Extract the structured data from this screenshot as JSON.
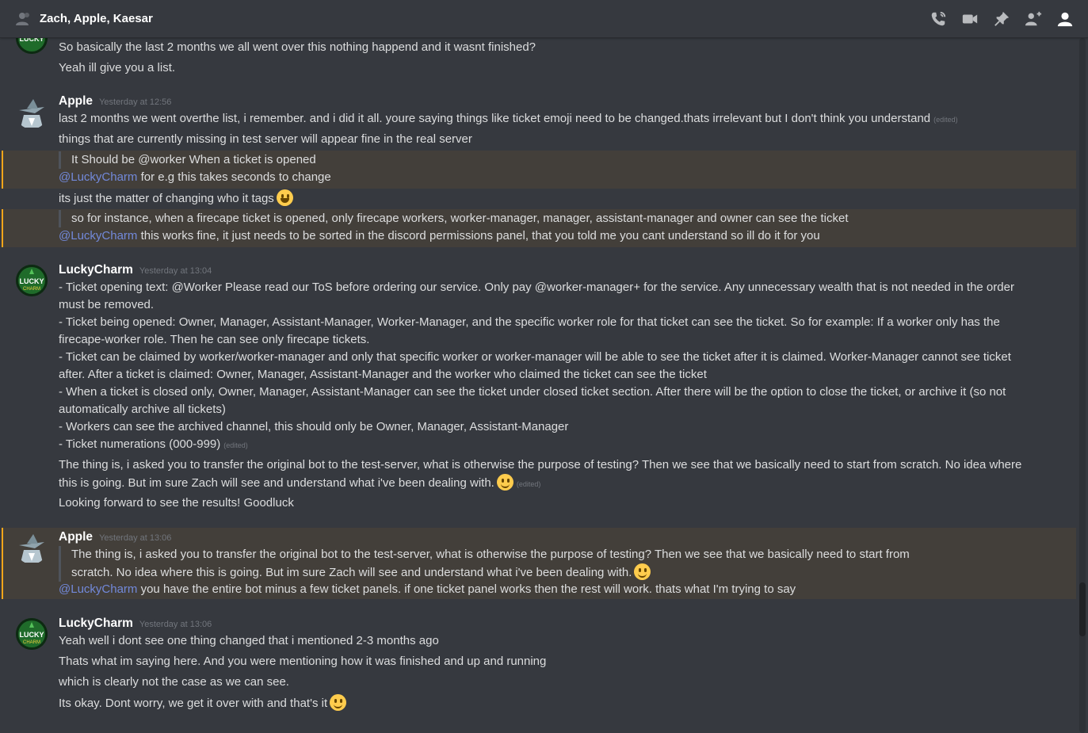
{
  "header": {
    "title": "Zach, Apple, Kaesar",
    "icons": [
      "people-icon",
      "call-icon",
      "video-icon",
      "pin-icon",
      "add-member-icon",
      "member-list-icon"
    ]
  },
  "emoji_names": [
    "grinning",
    "slight_smile"
  ],
  "messages": [
    {
      "lines": [
        "So basically the last 2 months we all went over this nothing happend and it wasnt finished?",
        "Yeah ill give you a list."
      ]
    },
    {
      "author": "Apple",
      "timestamp": "Yesterday at 12:56",
      "line1": "last 2 months we went overthe list, i remember. and i did it all. youre saying things like ticket emoji need to be changed.thats irrelevant but I don't think you understand",
      "line1_edited": "(edited)",
      "line2": "things that are currently missing in test server will appear fine in the real server",
      "quote1": "It Should be @worker When a ticket is opened",
      "mention1": "@LuckyCharm",
      "reply1": " for e.g this takes seconds to change",
      "line3": "its just the matter of changing who it tags",
      "quote2": "so for instance, when a firecape ticket is opened, only firecape workers, worker-manager, manager, assistant-manager and owner can see the ticket",
      "mention2": "@LuckyCharm",
      "reply2": " this works fine, it just needs to be sorted in the discord permissions panel, that you told me you cant understand so ill do it for you"
    },
    {
      "author": "LuckyCharm",
      "timestamp": "Yesterday at 13:04",
      "l1": "- Ticket opening text: @Worker Please read our ToS before ordering our service. Only pay @worker-manager+ for the service. Any unnecessary wealth that is not needed in the order",
      "l2": "must be removed.",
      "l3": "- Ticket being opened: Owner, Manager, Assistant-Manager, Worker-Manager, and the specific worker role for that ticket can see the ticket. So for example: If a worker only has the",
      "l4": "firecape-worker role. Then he can see only firecape tickets.",
      "l5": "- Ticket can be claimed by worker/worker-manager and only that specific worker or worker-manager will be able to see the ticket after it is claimed. Worker-Manager cannot see ticket",
      "l6": "after. After a ticket is claimed: Owner, Manager, Assistant-Manager and the worker who claimed the ticket can see the ticket",
      "l7": "- When a ticket is closed only, Owner, Manager, Assistant-Manager can see the ticket under closed ticket section. After there will be the option to close the ticket, or archive it (so not",
      "l8": "automatically archive all tickets)",
      "l9": "- Workers can see the archived channel, this should only be Owner, Manager, Assistant-Manager",
      "l10": "- Ticket numerations (000-999)",
      "l10_edited": "(edited)",
      "l11": "The thing is, i asked you to transfer the original bot to the test-server, what is otherwise the purpose of testing? Then we see that we basically need to start from scratch. No idea where",
      "l12": "this is going. But im sure Zach will see and understand what i've been dealing with.",
      "l12_edited": "(edited)",
      "l13": "Looking forward to see the results! Goodluck"
    },
    {
      "author": "Apple",
      "timestamp": "Yesterday at 13:06",
      "quote_l1": "The thing is, i asked you to transfer the original bot to the test-server, what is otherwise the purpose of testing? Then we see that we basically need to start from",
      "quote_l2": "scratch. No idea where this is going. But im sure Zach will see and understand what i've been dealing with.",
      "mention": "@LuckyCharm",
      "reply": " you have the entire bot minus a few ticket panels. if one ticket panel works then the rest will work. thats what I'm trying to say"
    },
    {
      "author": "LuckyCharm",
      "timestamp": "Yesterday at 13:06",
      "l1": "Yeah well i dont see one thing changed that i mentioned 2-3 months ago",
      "l2": "Thats what im saying here. And you were mentioning how it was finished and up and running",
      "l3": "which is clearly not the case as we can see.",
      "l4": "Its okay. Dont worry, we get it over with and that's it"
    }
  ]
}
